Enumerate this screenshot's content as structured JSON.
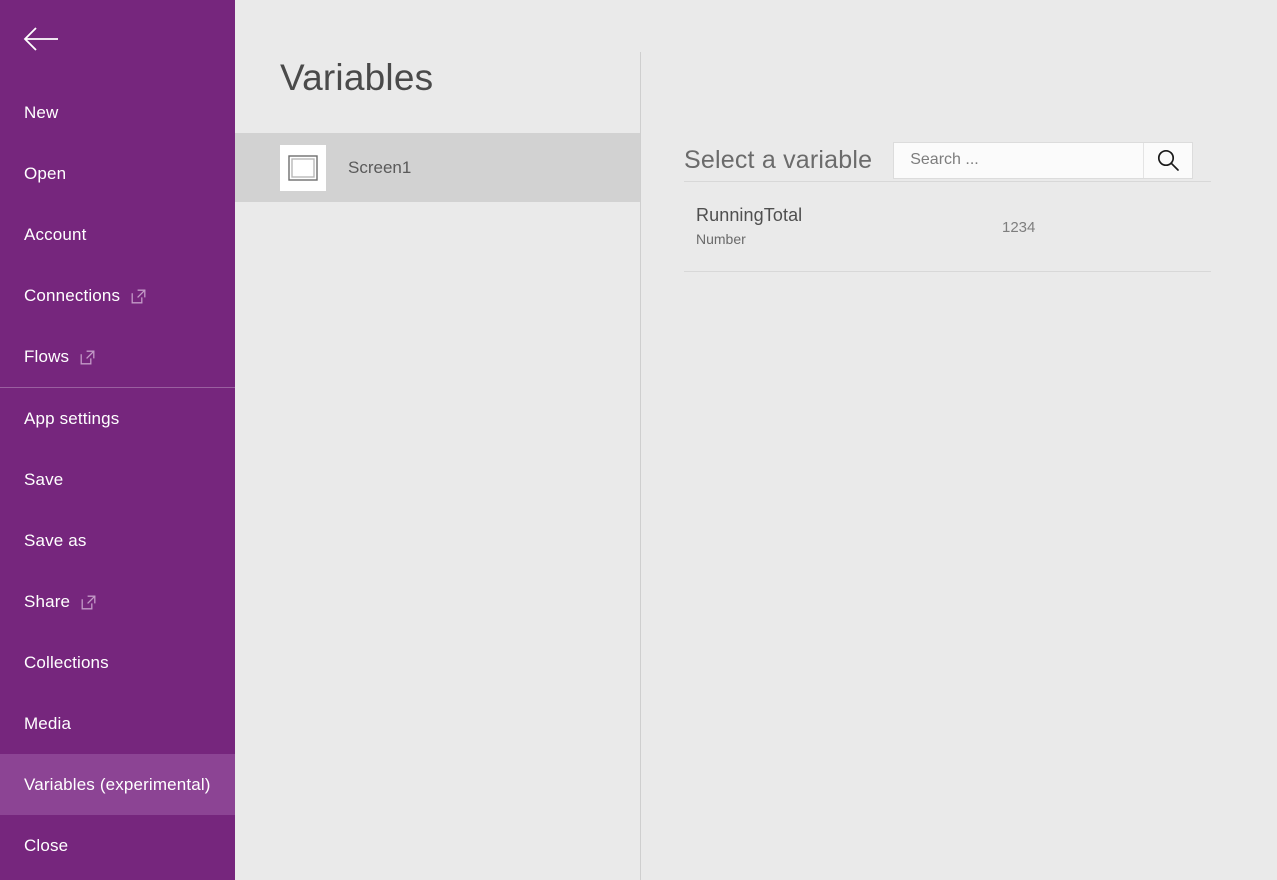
{
  "sidebar": {
    "accent_color": "#76267d",
    "selected_color": "#8c4494",
    "back_button_label": "Back",
    "items": [
      {
        "label": "New",
        "icon": "",
        "selected": false,
        "divider_after": false
      },
      {
        "label": "Open",
        "icon": "",
        "selected": false,
        "divider_after": false
      },
      {
        "label": "Account",
        "icon": "",
        "selected": false,
        "divider_after": false
      },
      {
        "label": "Connections",
        "icon": "open-in-new-icon",
        "selected": false,
        "divider_after": false
      },
      {
        "label": "Flows",
        "icon": "open-in-new-icon",
        "selected": false,
        "divider_after": true
      },
      {
        "label": "App settings",
        "icon": "",
        "selected": false,
        "divider_after": false
      },
      {
        "label": "Save",
        "icon": "",
        "selected": false,
        "divider_after": false
      },
      {
        "label": "Save as",
        "icon": "",
        "selected": false,
        "divider_after": false
      },
      {
        "label": "Share",
        "icon": "open-in-new-icon",
        "selected": false,
        "divider_after": false
      },
      {
        "label": "Collections",
        "icon": "",
        "selected": false,
        "divider_after": false
      },
      {
        "label": "Media",
        "icon": "",
        "selected": false,
        "divider_after": false
      },
      {
        "label": "Variables (experimental)",
        "icon": "",
        "selected": true,
        "divider_after": false
      },
      {
        "label": "Close",
        "icon": "",
        "selected": false,
        "divider_after": false
      }
    ]
  },
  "mid_panel": {
    "title": "Variables",
    "screens": [
      {
        "label": "Screen1",
        "icon": "screen-thumbnail-icon",
        "selected": true
      }
    ]
  },
  "right_panel": {
    "header_title": "Select a variable",
    "search": {
      "value": "",
      "placeholder": "Search ...",
      "icon": "search-icon"
    },
    "variables": [
      {
        "name": "RunningTotal",
        "type": "Number",
        "value": "1234"
      }
    ]
  }
}
